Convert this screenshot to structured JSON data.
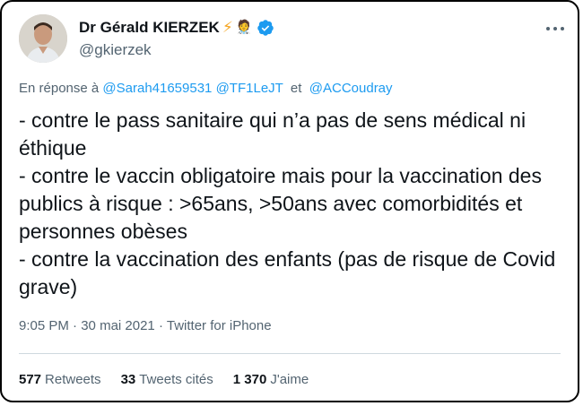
{
  "author": {
    "name": "Dr Gérald KIERZEK",
    "emoji_1": "⚡",
    "emoji_2": "🧑‍⚕️",
    "handle": "@gkierzek",
    "verified": true
  },
  "reply_to": {
    "prefix": "En réponse à",
    "mention_1": "@Sarah41659531",
    "mention_2": "@TF1LeJT",
    "connector": "et",
    "mention_3": "@ACCoudray"
  },
  "tweet": {
    "lines": [
      "- contre le pass sanitaire qui n’a pas de sens médical ni éthique",
      "- contre le vaccin obligatoire mais pour la vaccination des publics à risque : >65ans, >50ans avec comorbidités et personnes obèses",
      "- contre la vaccination des enfants (pas de risque de Covid grave)"
    ]
  },
  "meta": {
    "time": "9:05 PM",
    "date": "30 mai 2021",
    "separator": "·",
    "source": "Twitter for iPhone"
  },
  "stats": {
    "retweets_count": "577",
    "retweets_label": "Retweets",
    "quotes_count": "33",
    "quotes_label": "Tweets cités",
    "likes_count": "1 370",
    "likes_label": "J'aime"
  },
  "colors": {
    "link": "#1d9bf0",
    "secondary": "#536471",
    "verified": "#1d9bf0"
  }
}
